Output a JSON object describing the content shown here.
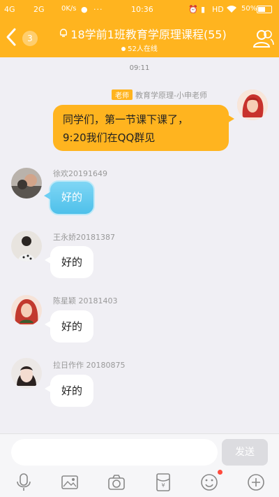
{
  "status_bar": {
    "carrier1": "4G",
    "carrier2": "2G",
    "speed": "0K/s",
    "time": "10:36",
    "hd": "HD",
    "battery": "50%"
  },
  "header": {
    "unread_count": "3",
    "title": "18学前1班教育学原理课程(55)",
    "online": "52人在线",
    "bg_color": "#ffb41f"
  },
  "timestamp": "09:11",
  "messages": [
    {
      "role": "老师",
      "sender": "教育学原理-小申老师",
      "lines": [
        "同学们，第一节课下课了，",
        "9:20我们在QQ群见"
      ]
    },
    {
      "sender": "徐欢20191649",
      "text": "好的"
    },
    {
      "sender": "王永娇20181387",
      "text": "好的"
    },
    {
      "sender": "陈星颖 20181403",
      "text": "好的"
    },
    {
      "sender": "拉日作作 20180875",
      "text": "好的"
    }
  ],
  "input": {
    "placeholder": "",
    "send_label": "发送"
  },
  "toolbar": {
    "icons": [
      "microphone-icon",
      "image-icon",
      "camera-icon",
      "red-packet-icon",
      "emoji-icon",
      "plus-icon"
    ]
  }
}
